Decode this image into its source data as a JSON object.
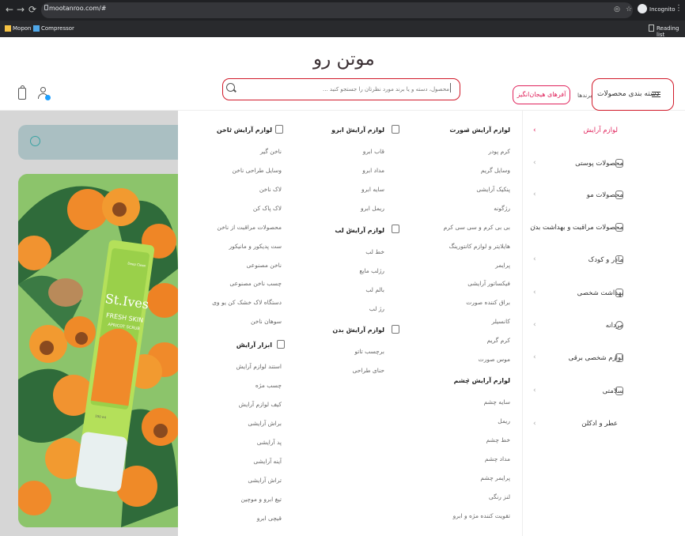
{
  "browser": {
    "url": "mootanroo.com/#",
    "incognito_label": "Incognito",
    "bookmarks": [
      "Mopon",
      "Compressor"
    ],
    "reading_list": "Reading list"
  },
  "header": {
    "logo": "موتن رو",
    "search_placeholder": "محصول، دسته و یا برند مورد نظرتان را جستجو کنید ...",
    "deals_label": "آفرهای هیجان‌انگیز",
    "brands_label": "برندها",
    "categories_label": "دسته بندی محصولات"
  },
  "sidebar": {
    "items": [
      {
        "label": "لوازم آرایش",
        "active": true
      },
      {
        "label": "محصولات پوستی"
      },
      {
        "label": "محصولات مو"
      },
      {
        "label": "محصولات مراقبت و بهداشت بدن"
      },
      {
        "label": "مادر و کودک"
      },
      {
        "label": "بهداشت شخصی"
      },
      {
        "label": "مردانه"
      },
      {
        "label": "لوازم شخصی برقی"
      },
      {
        "label": "سلامتی"
      },
      {
        "label": "عطر و ادکلن"
      }
    ]
  },
  "menu": {
    "col1": {
      "groups": [
        {
          "title": "لوازم آرایش صورت",
          "items": [
            "کرم پودر",
            "وسایل گریم",
            "پنکیک آرایشی",
            "رژگونه",
            "بی بی کرم و سی سی کرم",
            "هایلایتر و لوازم کانتورینگ",
            "پرایمر",
            "فیکساتور آرایشی",
            "براق کننده صورت",
            "کانسیلر",
            "کرم گریم",
            "موس صورت"
          ]
        },
        {
          "title": "لوازم آرایش چشم",
          "items": [
            "سایه چشم",
            "ریمل",
            "خط چشم",
            "مداد چشم",
            "پرایمر چشم",
            "لنز رنگی",
            "تقویت کننده مژه و ابرو"
          ]
        }
      ]
    },
    "col2": {
      "groups": [
        {
          "title": "لوازم آرایش ابرو",
          "items": [
            "قاب ابرو",
            "مداد ابرو",
            "سایه ابرو",
            "ریمل ابرو"
          ]
        },
        {
          "title": "لوازم آرایش لب",
          "items": [
            "خط لب",
            "رژلب مایع",
            "بالم لب",
            "رژ لب"
          ]
        },
        {
          "title": "لوازم آرایش بدن",
          "items": [
            "برچسب تاتو",
            "حنای طراحی"
          ]
        }
      ]
    },
    "col3": {
      "groups": [
        {
          "title": "لوازم آرایش ناخن",
          "items": [
            "ناخن گیر",
            "وسایل طراحی ناخن",
            "لاک ناخن",
            "لاک پاک کن",
            "محصولات مراقبت از ناخن",
            "ست پدیکور و مانیکور",
            "ناخن مصنوعی",
            "چسب ناخن مصنوعی",
            "دستگاه لاک خشک کن یو وی",
            "سوهان ناخن"
          ]
        },
        {
          "title": "ابزار آرایش",
          "items": [
            "استند لوازم آرایش",
            "چسب مژه",
            "کیف لوازم آرایش",
            "براش آرایشی",
            "پد آرایشی",
            "آینه آرایشی",
            "تراش آرایشی",
            "تیغ ابرو و موچین",
            "قیچی ابرو"
          ]
        }
      ]
    }
  },
  "product": {
    "brand": "St.Ives",
    "line": "FRESH SKIN",
    "variant": "APRICOT SCRUB",
    "badge": "Deep Clean",
    "net_label": "150 ml"
  },
  "colors": {
    "accent": "#e0225b",
    "highlight_box": "#d11a2a"
  }
}
